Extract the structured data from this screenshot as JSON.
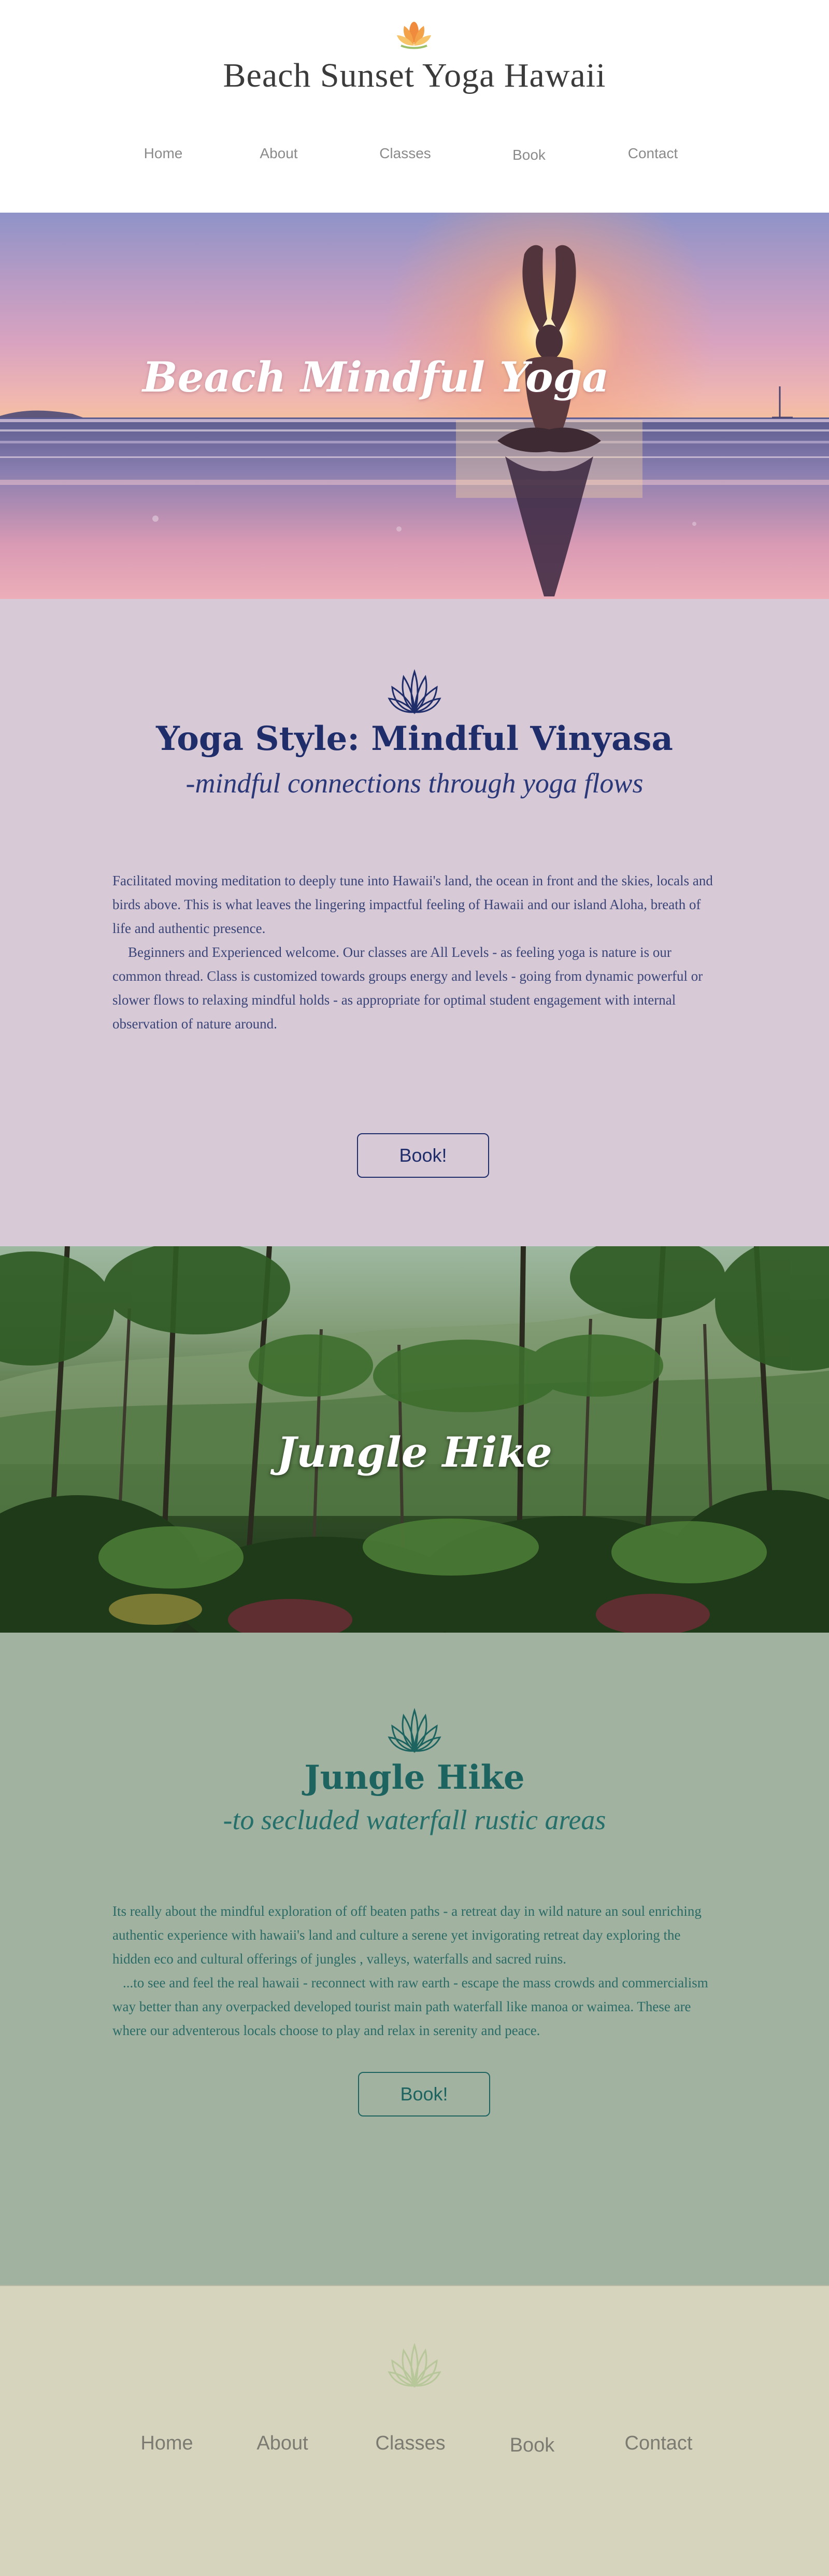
{
  "header": {
    "site_title": "Beach Sunset Yoga Hawaii",
    "logo_icon": "lotus-icon",
    "nav": [
      "Home",
      "About",
      "Classes",
      "Book",
      "Contact"
    ]
  },
  "hero_beach": {
    "title": "Beach Mindful Yoga"
  },
  "yoga_section": {
    "icon": "lotus-outline-icon",
    "title": "Yoga Style: Mindful Vinyasa",
    "subtitle": "-mindful connections through yoga flows",
    "paragraphs": [
      "Facilitated moving meditation to deeply tune into Hawaii's land, the ocean in front and the skies, locals and birds above.  This is what leaves the lingering impactful feeling of Hawaii and our island Aloha, breath of life and authentic presence.",
      "Beginners and Experienced welcome. Our classes are All Levels - as feeling yoga is nature is our common thread.  Class is customized towards groups energy and levels - going from dynamic powerful or slower flows to relaxing mindful holds - as appropriate for optimal student engagement with internal observation of nature around."
    ],
    "button_label": "Book!",
    "colors": {
      "background": "#d7cad6",
      "text": "#1f2d6b"
    }
  },
  "hero_jungle": {
    "title": "Jungle Hike"
  },
  "jungle_section": {
    "icon": "lotus-outline-icon",
    "title": "Jungle Hike",
    "subtitle": "-to secluded waterfall rustic areas",
    "paragraphs": [
      "Its really about the mindful exploration of off beaten paths - a retreat day in wild nature an soul enriching authentic experience with hawaii's land and culture a serene yet invigorating retreat day exploring the hidden eco and cultural offerings of jungles , valleys, waterfalls and sacred ruins.",
      "...to see and feel the real hawaii  - reconnect with raw earth - escape the mass crowds and commercialism way better than any overpacked developed tourist  main path waterfall like manoa or waimea. These are where our adventerous locals choose to play and relax in serenity and peace."
    ],
    "button_label": "Book!",
    "colors": {
      "background": "#a2b2a1",
      "text": "#1d6460"
    }
  },
  "footer": {
    "icon": "lotus-outline-icon",
    "nav": [
      "Home",
      "About",
      "Classes",
      "Book",
      "Contact"
    ],
    "colors": {
      "background": "#d6d4bd",
      "icon": "#b7c79a"
    }
  }
}
